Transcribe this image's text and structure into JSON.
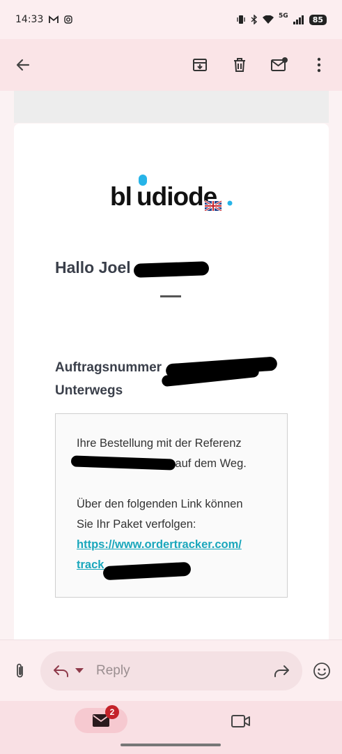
{
  "status_bar": {
    "time": "14:33",
    "network": "5G",
    "battery": "85"
  },
  "topbar": {
    "icons": [
      "back-arrow-icon",
      "archive-icon",
      "delete-icon",
      "mark-unread-icon",
      "more-vert-icon"
    ]
  },
  "email": {
    "logo_text": "bludiode",
    "greeting": "Hallo Joel",
    "order_label": "Auftragsnummer",
    "status_label": "Unterwegs",
    "box": {
      "line1": "Ihre Bestellung mit der Referenz",
      "line2_suffix": "st auf dem Weg.",
      "line3": "Über den folgenden Link können",
      "line4": "Sie Ihr Paket verfolgen:",
      "link_line1": "https://www.ordertracker.com/",
      "link_line2": "track"
    }
  },
  "reply_bar": {
    "placeholder": "Reply"
  },
  "bottom_nav": {
    "mail_badge": "2"
  },
  "colors": {
    "accent": "#1aa7bc",
    "badge": "#c4222a",
    "topbar_bg": "#fae4e7"
  }
}
